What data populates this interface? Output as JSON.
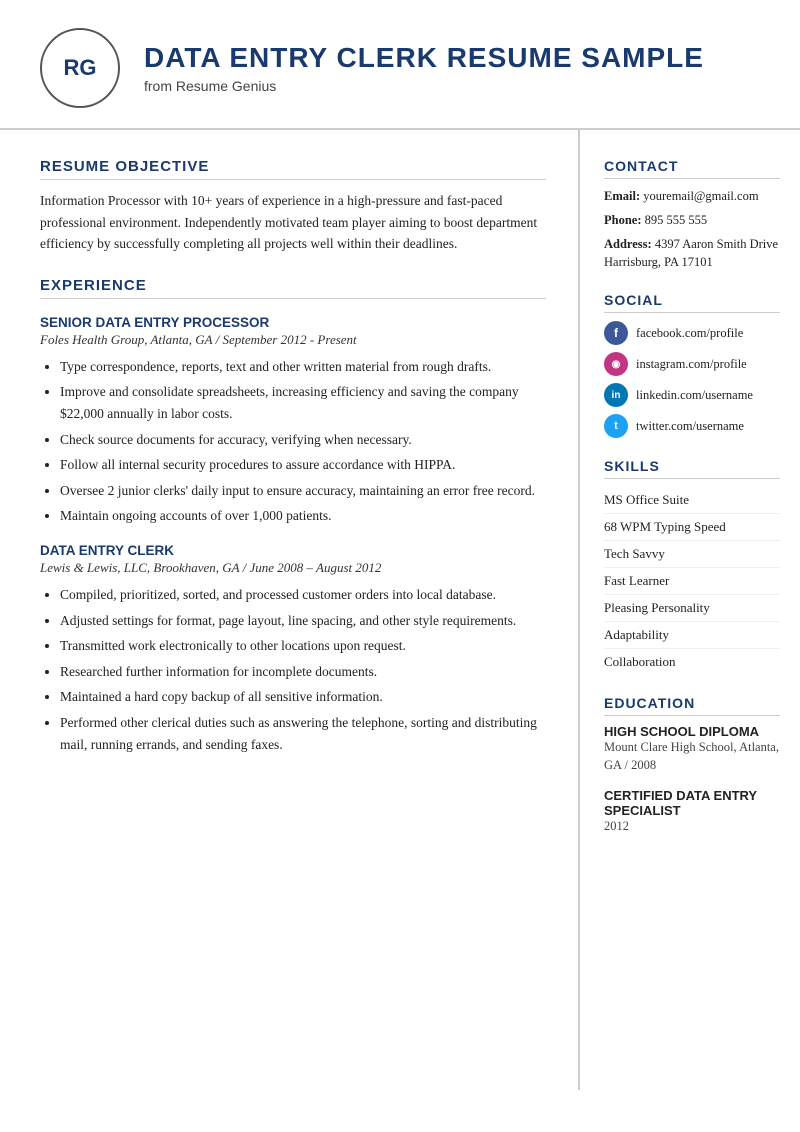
{
  "header": {
    "initials": "RG",
    "title": "DATA ENTRY CLERK RESUME SAMPLE",
    "subtitle": "from Resume Genius"
  },
  "left": {
    "objective_title": "RESUME OBJECTIVE",
    "objective_text": "Information Processor with 10+ years of experience in a high-pressure and fast-paced professional environment. Independently motivated team player aiming to boost department efficiency by successfully completing all projects well within their deadlines.",
    "experience_title": "EXPERIENCE",
    "jobs": [
      {
        "title": "SENIOR DATA ENTRY PROCESSOR",
        "meta": "Foles Health Group, Atlanta, GA  /  September 2012 - Present",
        "bullets": [
          "Type correspondence, reports, text and other written material from rough drafts.",
          "Improve and consolidate spreadsheets, increasing efficiency and saving the company $22,000 annually in labor costs.",
          "Check source documents for accuracy, verifying when necessary.",
          "Follow all internal security procedures to assure accordance with HIPPA.",
          "Oversee 2 junior clerks' daily input to ensure accuracy, maintaining an error free record.",
          "Maintain ongoing accounts of over 1,000 patients."
        ]
      },
      {
        "title": "DATA ENTRY CLERK",
        "meta": "Lewis & Lewis, LLC, Brookhaven, GA  /  June 2008 – August 2012",
        "bullets": [
          "Compiled, prioritized, sorted, and processed customer orders into local database.",
          "Adjusted settings for format, page layout, line spacing, and other style requirements.",
          "Transmitted work electronically to other locations upon request.",
          "Researched further information for incomplete documents.",
          "Maintained a hard copy backup of all sensitive information.",
          "Performed other clerical duties such as answering the telephone, sorting and distributing mail, running errands, and sending faxes."
        ]
      }
    ]
  },
  "right": {
    "contact_title": "CONTACT",
    "contact": {
      "email_label": "Email:",
      "email": "youremail@gmail.com",
      "phone_label": "Phone:",
      "phone": "895 555 555",
      "address_label": "Address:",
      "address": "4397 Aaron Smith Drive Harrisburg, PA 17101"
    },
    "social_title": "SOCIAL",
    "social": [
      {
        "platform": "facebook",
        "url": "facebook.com/profile",
        "icon": "f",
        "color_class": "fb-icon"
      },
      {
        "platform": "instagram",
        "url": "instagram.com/profile",
        "icon": "📷",
        "color_class": "ig-icon"
      },
      {
        "platform": "linkedin",
        "url": "linkedin.com/username",
        "icon": "in",
        "color_class": "li-icon"
      },
      {
        "platform": "twitter",
        "url": "twitter.com/username",
        "icon": "t",
        "color_class": "tw-icon"
      }
    ],
    "skills_title": "SKILLS",
    "skills": [
      "MS Office Suite",
      "68 WPM Typing Speed",
      "Tech Savvy",
      "Fast Learner",
      "Pleasing Personality",
      "Adaptability",
      "Collaboration"
    ],
    "education_title": "EDUCATION",
    "education": [
      {
        "degree": "HIGH SCHOOL DIPLOMA",
        "details": "Mount Clare High School, Atlanta, GA / 2008"
      },
      {
        "degree": "CERTIFIED DATA ENTRY SPECIALIST",
        "details": "2012"
      }
    ]
  }
}
